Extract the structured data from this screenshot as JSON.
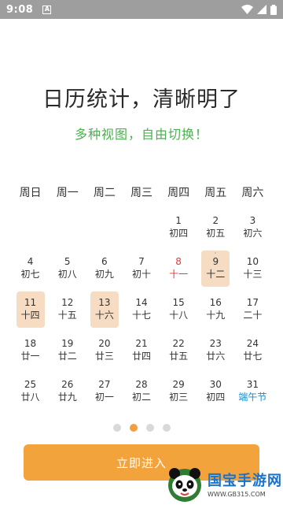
{
  "status_bar": {
    "time": "9:08",
    "notification_icon": "a-box-icon",
    "icons": [
      "wifi-icon",
      "signal-icon",
      "battery-icon"
    ]
  },
  "headline": "日历统计，清晰明了",
  "subhead": "多种视图，自由切换！",
  "weekdays": [
    "周日",
    "周一",
    "周二",
    "周三",
    "周四",
    "周五",
    "周六"
  ],
  "calendar": [
    [
      null,
      null,
      null,
      null,
      {
        "day": "1",
        "lunar": "初四"
      },
      {
        "day": "2",
        "lunar": "初五"
      },
      {
        "day": "3",
        "lunar": "初六"
      }
    ],
    [
      {
        "day": "4",
        "lunar": "初七"
      },
      {
        "day": "5",
        "lunar": "初八"
      },
      {
        "day": "6",
        "lunar": "初九"
      },
      {
        "day": "7",
        "lunar": "初十"
      },
      {
        "day": "8",
        "lunar": "十一",
        "style": "red"
      },
      {
        "day": "9",
        "lunar": "十二",
        "highlight": true,
        "dot": true
      },
      {
        "day": "10",
        "lunar": "十三"
      }
    ],
    [
      {
        "day": "11",
        "lunar": "十四",
        "highlight": true
      },
      {
        "day": "12",
        "lunar": "十五"
      },
      {
        "day": "13",
        "lunar": "十六",
        "highlight": true
      },
      {
        "day": "14",
        "lunar": "十七"
      },
      {
        "day": "15",
        "lunar": "十八"
      },
      {
        "day": "16",
        "lunar": "十九"
      },
      {
        "day": "17",
        "lunar": "二十"
      }
    ],
    [
      {
        "day": "18",
        "lunar": "廿一"
      },
      {
        "day": "19",
        "lunar": "廿二"
      },
      {
        "day": "20",
        "lunar": "廿三"
      },
      {
        "day": "21",
        "lunar": "廿四"
      },
      {
        "day": "22",
        "lunar": "廿五"
      },
      {
        "day": "23",
        "lunar": "廿六"
      },
      {
        "day": "24",
        "lunar": "廿七"
      }
    ],
    [
      {
        "day": "25",
        "lunar": "廿八"
      },
      {
        "day": "26",
        "lunar": "廿九"
      },
      {
        "day": "27",
        "lunar": "初一"
      },
      {
        "day": "28",
        "lunar": "初二"
      },
      {
        "day": "29",
        "lunar": "初三"
      },
      {
        "day": "30",
        "lunar": "初四"
      },
      {
        "day": "31",
        "lunar": "端午节",
        "style": "festival"
      }
    ]
  ],
  "pager": {
    "count": 4,
    "active_index": 1
  },
  "cta_label": "立即进入",
  "watermark": {
    "title": "国宝手游网",
    "url": "WWW.GB315.COM"
  },
  "colors": {
    "accent": "#f2a33c",
    "subhead_green": "#4caf50",
    "highlight_bg": "#f6dcc2",
    "holiday_red": "#e53935",
    "festival_blue": "#1e88c7"
  }
}
